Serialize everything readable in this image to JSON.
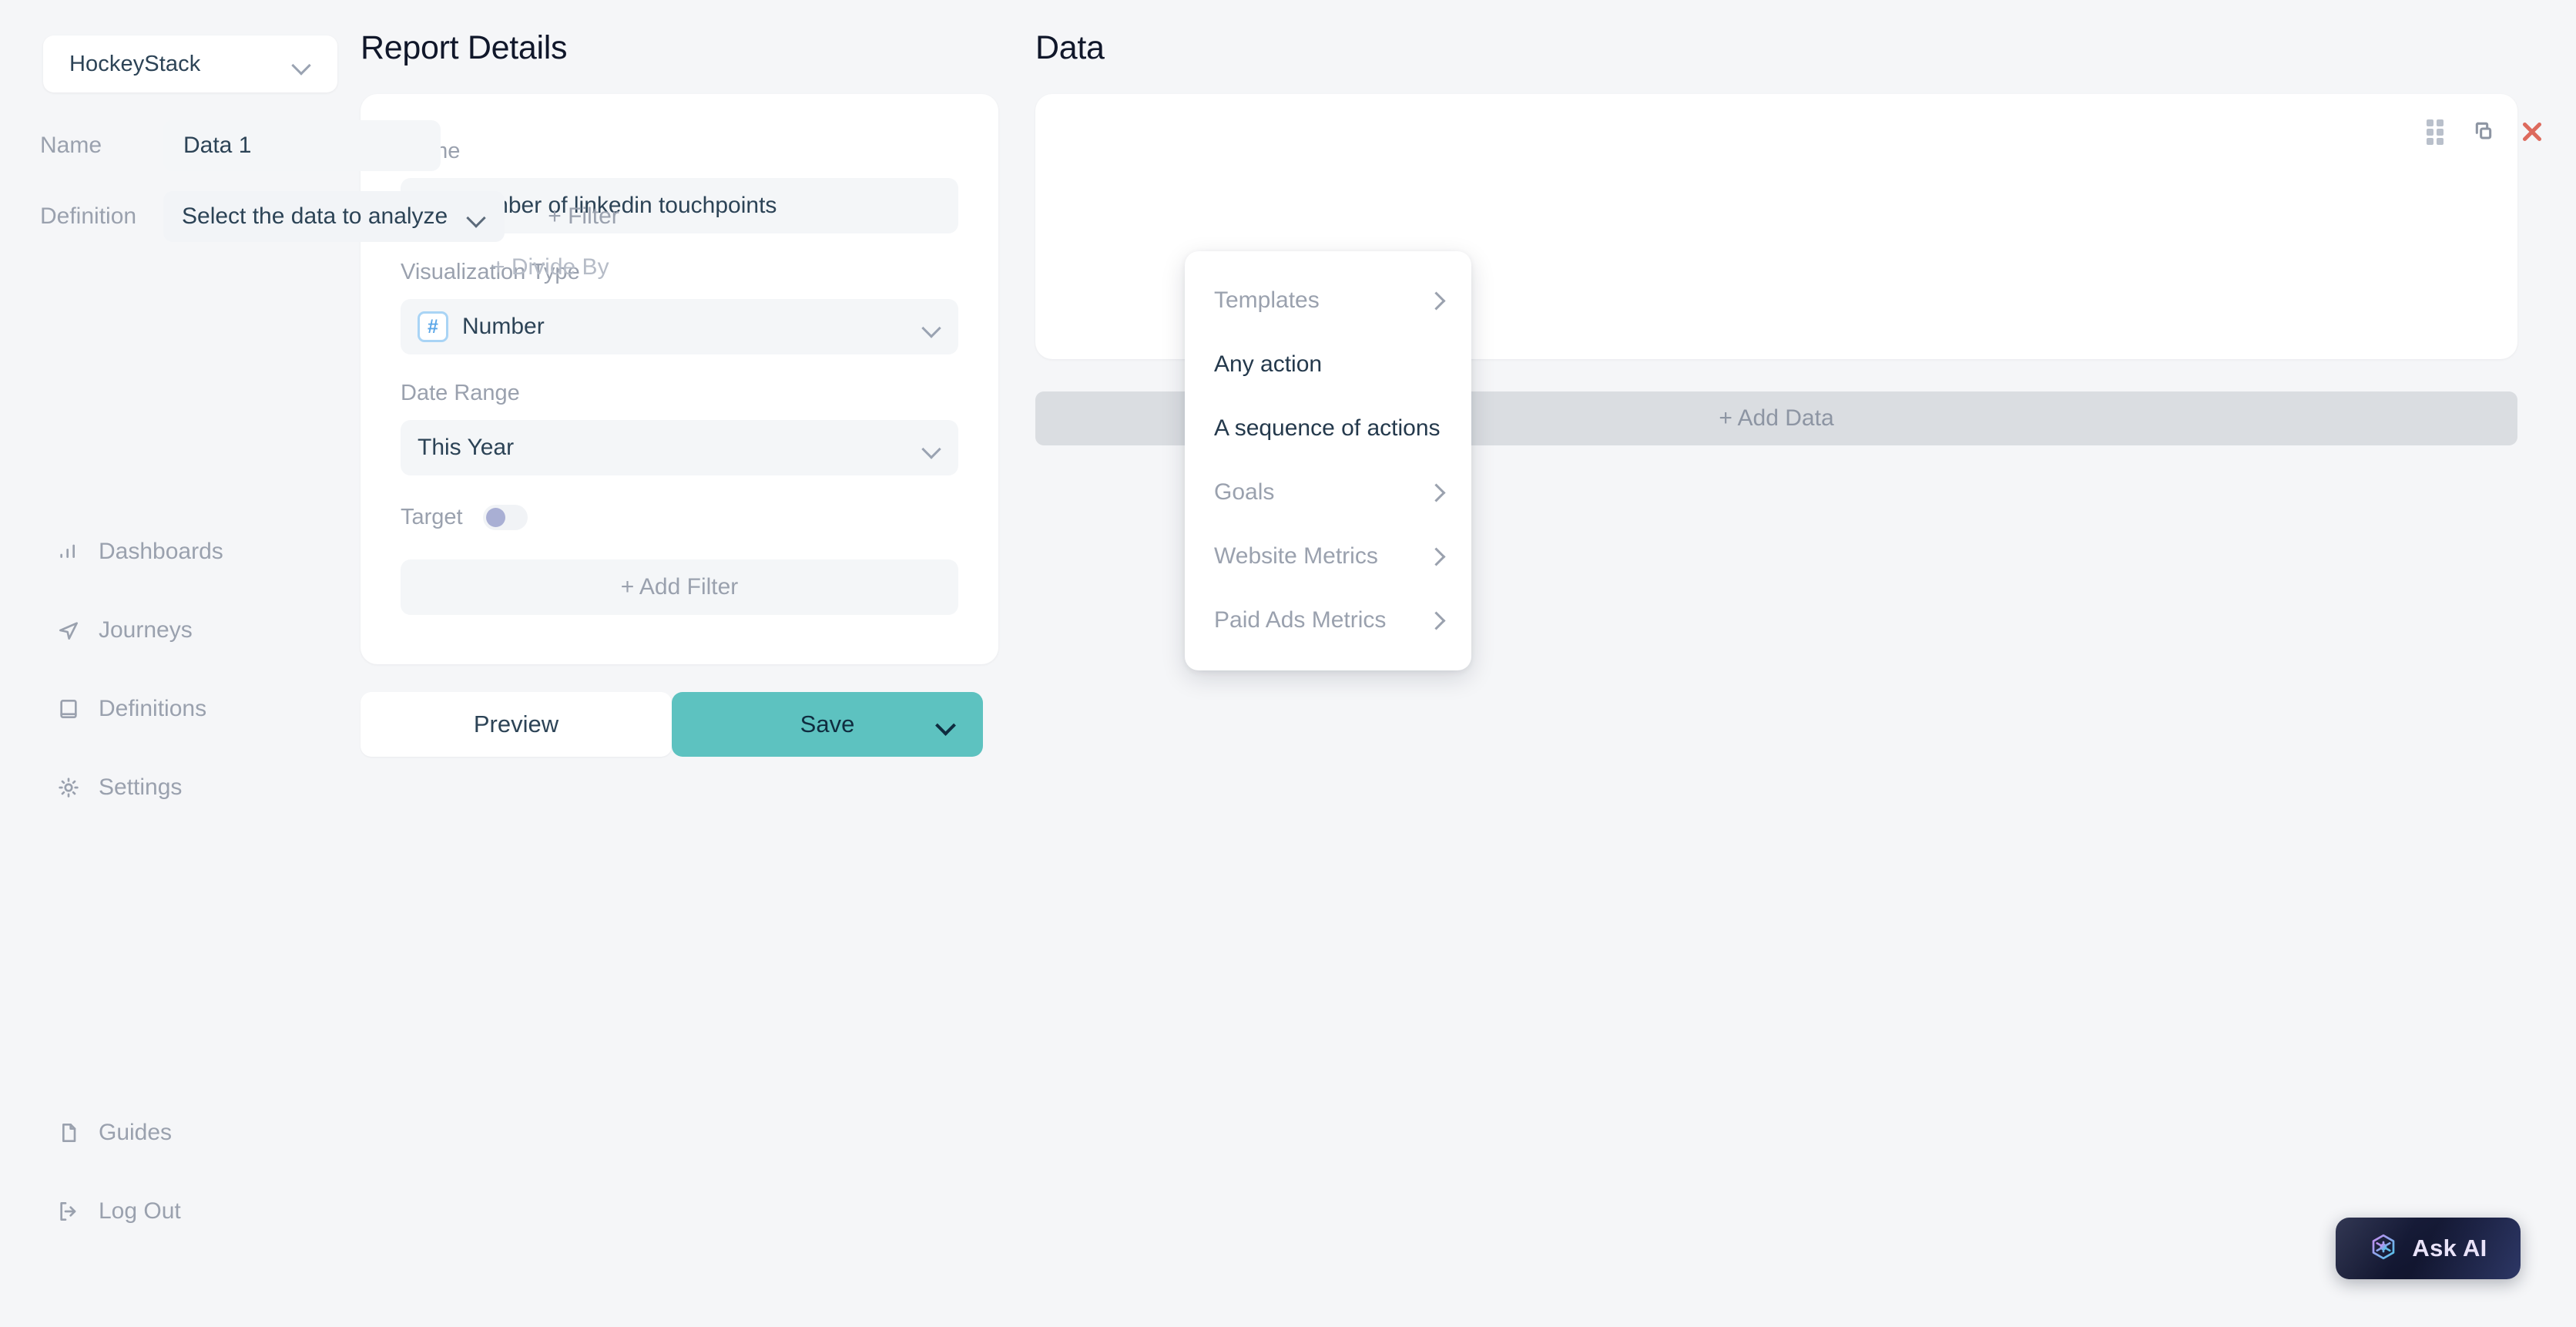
{
  "sidebar": {
    "workspace": {
      "name": "HockeyStack",
      "icon": "chevron-down-icon"
    },
    "main_items": [
      {
        "label": "Dashboards",
        "icon": "bar-chart-icon"
      },
      {
        "label": "Journeys",
        "icon": "navigation-arrow-icon"
      },
      {
        "label": "Definitions",
        "icon": "book-icon"
      },
      {
        "label": "Settings",
        "icon": "gear-icon"
      }
    ],
    "bottom_items": [
      {
        "label": "Guides",
        "icon": "document-icon"
      },
      {
        "label": "Log Out",
        "icon": "logout-icon"
      }
    ]
  },
  "report_details": {
    "title": "Report Details",
    "name": {
      "label": "Name",
      "value": "Avg number of linkedin touchpoints"
    },
    "visualization_type": {
      "label": "Visualization Type",
      "value": "Number",
      "icon": "hash-number-icon"
    },
    "date_range": {
      "label": "Date Range",
      "value": "This Year"
    },
    "target": {
      "label": "Target",
      "enabled": false
    },
    "add_filter_label": "+ Add Filter"
  },
  "actions": {
    "preview_label": "Preview",
    "save_label": "Save",
    "save_chevron_icon": "chevron-down-icon"
  },
  "data_panel": {
    "title": "Data",
    "card": {
      "name_label": "Name",
      "name_value": "Data 1",
      "definition_label": "Definition",
      "definition_value": "Select the data to analyze",
      "definition_chevron_icon": "chevron-down-icon",
      "filter_label": "+ Filter",
      "divide_by_label": "+ Divide By",
      "tools": {
        "drag_icon": "drag-handle-icon",
        "duplicate_icon": "copy-icon",
        "close_icon": "close-x-icon"
      }
    },
    "add_data_label": "+ Add Data"
  },
  "dropdown": {
    "items": [
      {
        "label": "Templates",
        "has_submenu": true,
        "emphasis": "muted"
      },
      {
        "label": "Any action",
        "has_submenu": false,
        "emphasis": "strong"
      },
      {
        "label": "A sequence of actions",
        "has_submenu": false,
        "emphasis": "strong"
      },
      {
        "label": "Goals",
        "has_submenu": true,
        "emphasis": "muted"
      },
      {
        "label": "Website Metrics",
        "has_submenu": true,
        "emphasis": "muted"
      },
      {
        "label": "Paid Ads Metrics",
        "has_submenu": true,
        "emphasis": "muted"
      }
    ]
  },
  "ask_ai": {
    "label": "Ask AI",
    "icon": "hexagon-ai-icon"
  },
  "colors": {
    "page_background": "#f5f6f8",
    "card_background": "#ffffff",
    "field_background": "#f4f6f8",
    "accent_save": "#5dc2c0",
    "text_primary": "#2c4356",
    "text_muted": "#9aa1ae",
    "close_red": "#dd6a5d",
    "viz_icon_blue": "#5ba7e8",
    "ask_ai_dark": "#121630"
  }
}
